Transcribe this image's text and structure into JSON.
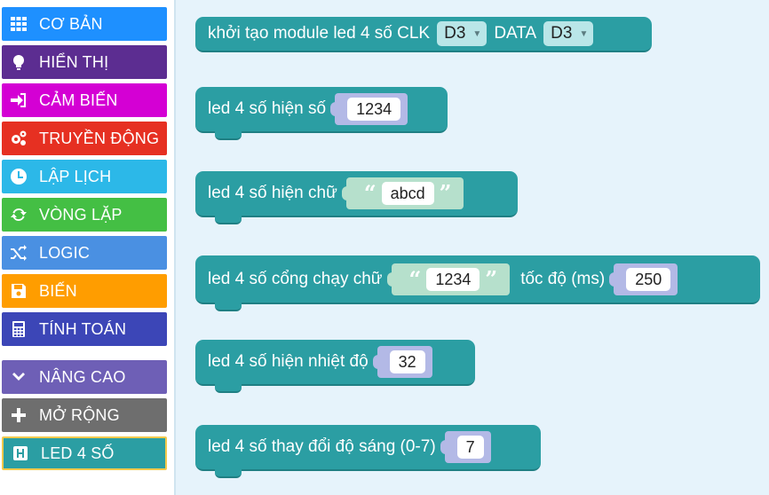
{
  "categories": [
    {
      "label": "CƠ BẢN",
      "icon": "grid-icon",
      "color": "#1e90ff"
    },
    {
      "label": "HIỂN THỊ",
      "icon": "lightbulb-icon",
      "color": "#5c2d91"
    },
    {
      "label": "CẢM BIẾN",
      "icon": "sign-in-icon",
      "color": "#d400d4"
    },
    {
      "label": "TRUYỀN ĐỘNG",
      "icon": "gears-icon",
      "color": "#e63022"
    },
    {
      "label": "LẬP LỊCH",
      "icon": "clock-icon",
      "color": "#2cb8e8"
    },
    {
      "label": "VÒNG LẶP",
      "icon": "refresh-icon",
      "color": "#44bf44"
    },
    {
      "label": "LOGIC",
      "icon": "shuffle-icon",
      "color": "#4a90e2"
    },
    {
      "label": "BIẾN",
      "icon": "save-icon",
      "color": "#ff9d00"
    },
    {
      "label": "TÍNH TOÁN",
      "icon": "calculator-icon",
      "color": "#3c46b7"
    },
    {
      "label": "NÂNG CAO",
      "icon": "chevron-down-icon",
      "color": "#6e5fb6"
    },
    {
      "label": "MỞ RỘNG",
      "icon": "plus-icon",
      "color": "#6e6e6e"
    },
    {
      "label": "LED 4 SỐ",
      "icon": "h-box-icon",
      "color": "#2b9ea3"
    }
  ],
  "blocks": {
    "init": {
      "label_a": "khởi tạo module led 4 số CLK",
      "clk": "D3",
      "label_b": "DATA",
      "data": "D3"
    },
    "show_number": {
      "label": "led 4 số hiện số",
      "value": "1234"
    },
    "show_text": {
      "label": "led 4 số hiện chữ",
      "open_quote": "“",
      "value": "abcd",
      "close_quote": "”"
    },
    "scroll_text": {
      "label": "led 4 số cổng chạy chữ",
      "open_quote": "“",
      "value": "1234",
      "close_quote": "”",
      "speed_label": "tốc độ (ms)",
      "speed": "250"
    },
    "show_temp": {
      "label": "led 4 số hiện nhiệt độ",
      "value": "32"
    },
    "brightness": {
      "label": "led 4 số thay đổi độ sáng (0-7)",
      "value": "7"
    }
  }
}
